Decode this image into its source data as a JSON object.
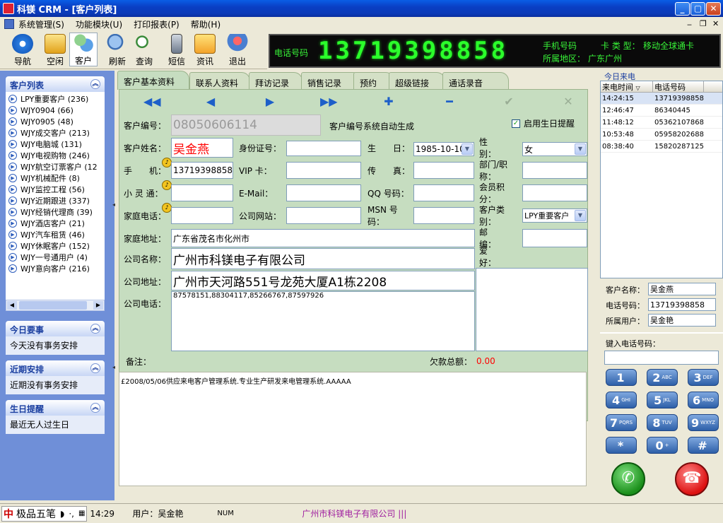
{
  "window": {
    "title": "科镁 CRM - [客户列表]"
  },
  "menu": {
    "items": [
      "系统管理(S)",
      "功能模块(U)",
      "打印报表(P)",
      "帮助(H)"
    ]
  },
  "toolbar": {
    "buttons": [
      "导航",
      "空闲",
      "客户",
      "刷新",
      "查询",
      "短信",
      "资讯",
      "退出"
    ]
  },
  "led": {
    "phone_label": "电话号码",
    "phone_number": "13719398858",
    "mobile_label": "手机号码",
    "card_type_label": "卡 类 型：",
    "card_type": "移动全球通卡",
    "region_label": "所属地区：",
    "region": "广东广州"
  },
  "customer_list": {
    "title": "客户列表",
    "items": [
      "LPY重要客户 (236)",
      "WJY0904 (66)",
      "WJY0905 (48)",
      "WJY成交客户 (213)",
      "WJY电脑城 (131)",
      "WJY电视购物 (246)",
      "WJY航空订票客户 (12",
      "WJY机械配件 (8)",
      "WJY监控工程 (56)",
      "WJY近期跟进 (337)",
      "WJY经销代理商 (39)",
      "WJY酒店客户 (21)",
      "WJY汽车租赁 (46)",
      "WJY休眠客户 (152)",
      "WJY一号通用户 (4)",
      "WJY意向客户 (216)"
    ]
  },
  "panels": {
    "today": {
      "title": "今日要事",
      "text": "今天没有事务安排"
    },
    "recent": {
      "title": "近期安排",
      "text": "近期没有事务安排"
    },
    "birthday": {
      "title": "生日提醒",
      "text": "最近无人过生日"
    }
  },
  "tabs": [
    "客户基本资料",
    "联系人资料",
    "拜访记录",
    "销售记录",
    "预约",
    "超级链接",
    "通话录音"
  ],
  "form": {
    "cust_no_label": "客户编号：",
    "cust_no": "08050606114",
    "cust_no_note": "客户编号系统自动生成",
    "birthday_reminder": "启用生日提醒",
    "name_label": "客户姓名：",
    "name": "吴金燕",
    "id_label": "身份证号：",
    "id_value": "",
    "birth_label": "生　　日：",
    "birth": "1985-10-10",
    "gender_label": "性　　别：",
    "gender": "女",
    "mobile_label": "手　　机：",
    "mobile": "13719398858",
    "vip_label": "VIP 卡：",
    "vip": "",
    "fax_label": "传　　真：",
    "fax": "",
    "dept_label": "部门/职称：",
    "dept": "",
    "pas_label": "小 灵 通：",
    "pas": "",
    "email_label": "E-Mail：",
    "email": "",
    "qq_label": "QQ 号码：",
    "qq": "",
    "points_label": "会员积分：",
    "points": "",
    "home_phone_label": "家庭电话：",
    "home_phone": "",
    "website_label": "公司网站：",
    "website": "",
    "msn_label": "MSN 号码：",
    "msn": "",
    "cust_type_label": "客户类别：",
    "cust_type": "LPY重要客户",
    "home_addr_label": "家庭地址：",
    "home_addr": "广东省茂名市化州市",
    "zip_label": "邮　　编：",
    "zip": "",
    "company_label": "公司名称：",
    "company": "广州市科镁电子有限公司",
    "hobby_label": "爱　　好：",
    "company_addr_label": "公司地址：",
    "company_addr": "广州市天河路551号龙苑大厦A1栋2208",
    "company_phone_label": "公司电话：",
    "company_phone": "87578151,88304117,85266767,87597926",
    "remark_label": "备注：",
    "debt_label": "欠款总额：",
    "debt": "0.00",
    "remark": "£2008/05/06供应来电客户管理系统.专业生产研发来电管理系统.AAAAA"
  },
  "calls": {
    "title": "今日来电",
    "col_time": "来电时间",
    "col_number": "电话号码",
    "rows": [
      [
        "14:24:15",
        "13719398858"
      ],
      [
        "12:46:47",
        "86340445"
      ],
      [
        "11:48:12",
        "05362107868"
      ],
      [
        "10:53:48",
        "05958202688"
      ],
      [
        "08:38:40",
        "15820287125"
      ]
    ]
  },
  "caller": {
    "name_label": "客户名称：",
    "name": "吴金燕",
    "phone_label": "电话号码：",
    "phone": "13719398858",
    "user_label": "所属用户：",
    "user": "吴金艳"
  },
  "dialpad": {
    "input_label": "键入电话号码：",
    "keys": [
      [
        "1",
        ""
      ],
      [
        "2",
        "ABC"
      ],
      [
        "3",
        "DEF"
      ],
      [
        "4",
        "GHI"
      ],
      [
        "5",
        "JKL"
      ],
      [
        "6",
        "MNO"
      ],
      [
        "7",
        "PQRS"
      ],
      [
        "8",
        "TUV"
      ],
      [
        "9",
        "WXYZ"
      ],
      [
        "*",
        ""
      ],
      [
        "0",
        "+"
      ],
      [
        "#",
        ""
      ]
    ]
  },
  "status": {
    "ime": "极品五笔",
    "time": "14:29",
    "user": "用户：吴金艳",
    "num": "NUM",
    "company": "广州市科镁电子有限公司 |||"
  },
  "colors": {
    "title_bar": "#0a3fc4",
    "led": "#2bff2b",
    "side_panel": "#6f8fd8",
    "form_bg": "#c6ddc0",
    "accent_red": "#ff0000"
  }
}
